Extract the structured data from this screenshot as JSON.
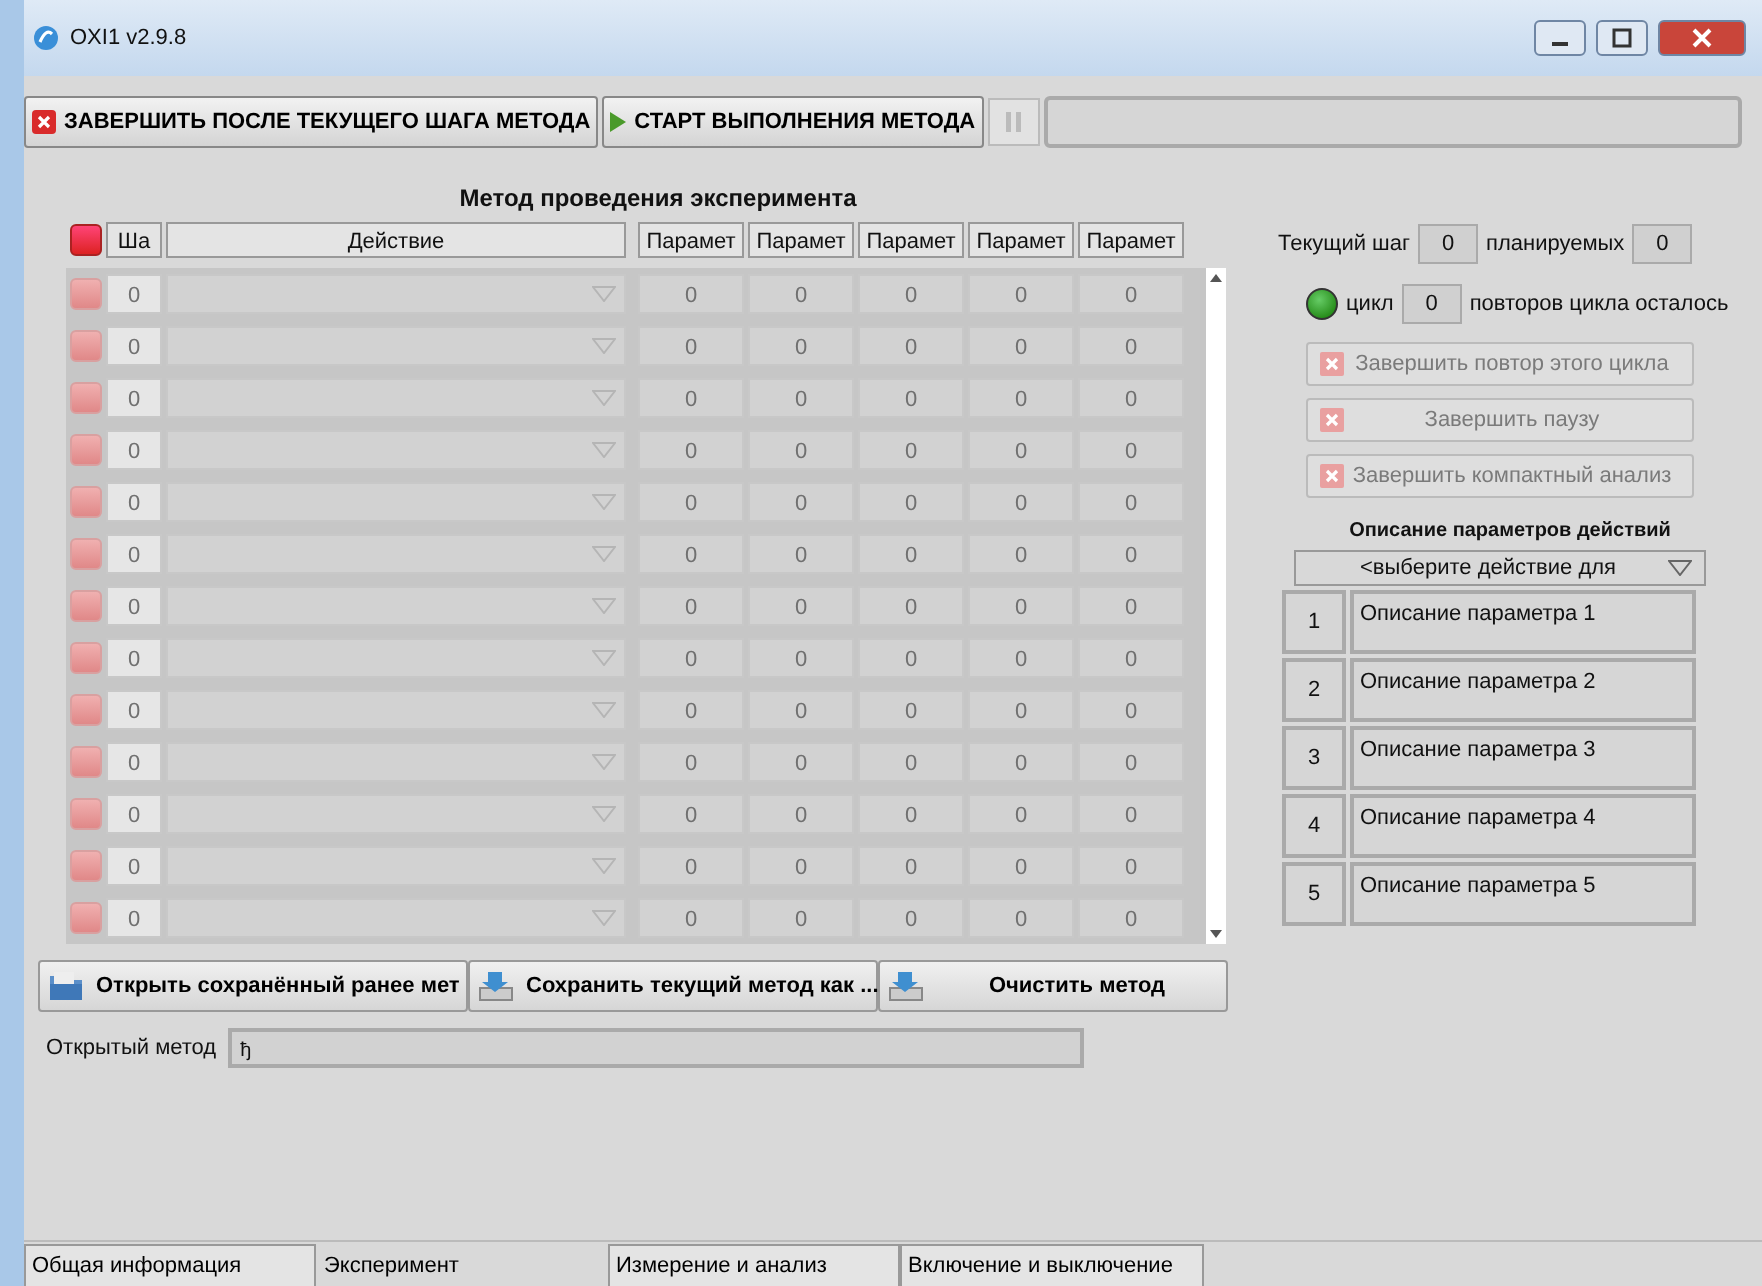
{
  "window": {
    "title": "OXI1 v2.9.8"
  },
  "toolbar": {
    "stop_button": "ЗАВЕРШИТЬ ПОСЛЕ ТЕКУЩЕГО ШАГА МЕТОДА",
    "start_button": "СТАРТ ВЫПОЛНЕНИЯ МЕТОДА"
  },
  "method": {
    "title": "Метод проведения эксперимента",
    "columns": [
      "Ша",
      "Действие",
      "Парамет",
      "Парамет",
      "Парамет",
      "Парамет",
      "Парамет"
    ],
    "rows": [
      {
        "step": "0",
        "params": [
          "0",
          "0",
          "0",
          "0",
          "0"
        ]
      },
      {
        "step": "0",
        "params": [
          "0",
          "0",
          "0",
          "0",
          "0"
        ]
      },
      {
        "step": "0",
        "params": [
          "0",
          "0",
          "0",
          "0",
          "0"
        ]
      },
      {
        "step": "0",
        "params": [
          "0",
          "0",
          "0",
          "0",
          "0"
        ]
      },
      {
        "step": "0",
        "params": [
          "0",
          "0",
          "0",
          "0",
          "0"
        ]
      },
      {
        "step": "0",
        "params": [
          "0",
          "0",
          "0",
          "0",
          "0"
        ]
      },
      {
        "step": "0",
        "params": [
          "0",
          "0",
          "0",
          "0",
          "0"
        ]
      },
      {
        "step": "0",
        "params": [
          "0",
          "0",
          "0",
          "0",
          "0"
        ]
      },
      {
        "step": "0",
        "params": [
          "0",
          "0",
          "0",
          "0",
          "0"
        ]
      },
      {
        "step": "0",
        "params": [
          "0",
          "0",
          "0",
          "0",
          "0"
        ]
      },
      {
        "step": "0",
        "params": [
          "0",
          "0",
          "0",
          "0",
          "0"
        ]
      },
      {
        "step": "0",
        "params": [
          "0",
          "0",
          "0",
          "0",
          "0"
        ]
      },
      {
        "step": "0",
        "params": [
          "0",
          "0",
          "0",
          "0",
          "0"
        ]
      }
    ]
  },
  "status": {
    "current_step_label": "Текущий шаг",
    "current_step": "0",
    "planned_label": "планируемых",
    "planned": "0",
    "cycle_on": true,
    "cycle_label": "цикл",
    "cycle_count": "0",
    "cycle_remaining_label": "повторов цикла осталось"
  },
  "action_buttons": [
    {
      "label": "Завершить повтор этого цикла",
      "disabled": true
    },
    {
      "label": "Завершить паузу",
      "disabled": true
    },
    {
      "label": "Завершить компактный анализ",
      "disabled": true
    }
  ],
  "param_descriptions": {
    "title": "Описание параметров действий",
    "dropdown": "<выберите действие для",
    "items": [
      {
        "index": "1",
        "text": "Описание параметра 1"
      },
      {
        "index": "2",
        "text": "Описание параметра 2"
      },
      {
        "index": "3",
        "text": "Описание параметра 3"
      },
      {
        "index": "4",
        "text": "Описание параметра 4"
      },
      {
        "index": "5",
        "text": "Описание параметра 5"
      }
    ]
  },
  "file_buttons": [
    "Открыть сохранённый ранее мет",
    "Сохранить текущий метод как ...",
    "Очистить метод"
  ],
  "opened_method": {
    "label": "Открытый метод",
    "value": "ђ"
  },
  "tabs": [
    {
      "label": "Общая информация",
      "selected": false
    },
    {
      "label": "Эксперимент",
      "selected": true
    },
    {
      "label": "Измерение и анализ",
      "selected": false
    },
    {
      "label": "Включение и выключение",
      "selected": false
    }
  ]
}
